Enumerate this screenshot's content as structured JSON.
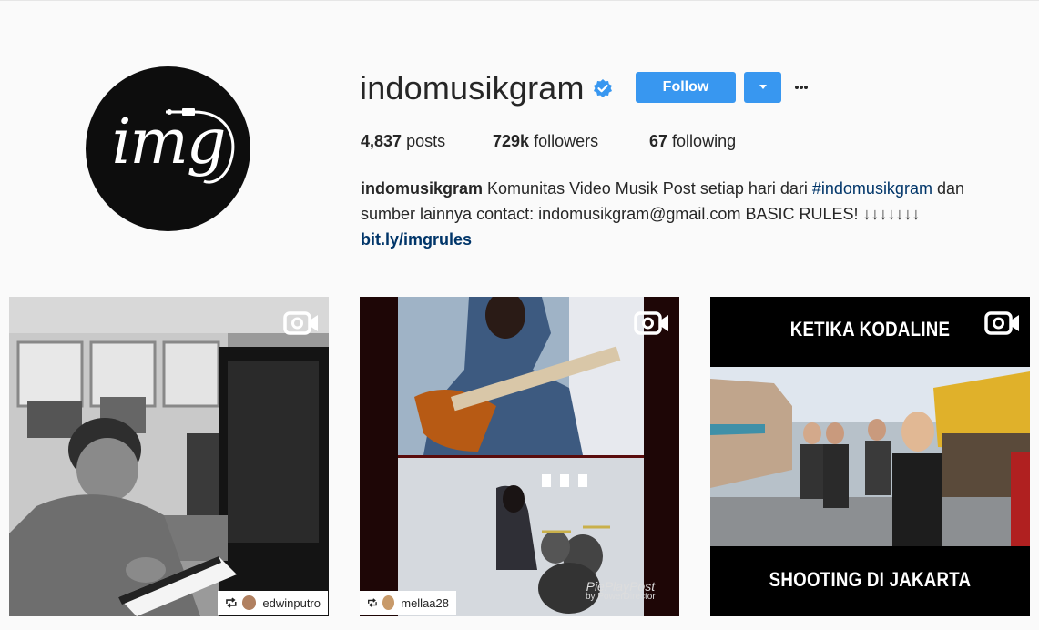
{
  "profile": {
    "username": "indomusikgram",
    "verified": true,
    "avatar_logo_text": "img",
    "follow_label": "Follow",
    "more_label": "•••"
  },
  "stats": {
    "posts_count": "4,837",
    "posts_label": "posts",
    "followers_count": "729k",
    "followers_label": "followers",
    "following_count": "67",
    "following_label": "following"
  },
  "bio": {
    "name": "indomusikgram",
    "text1": " Komunitas Video Musik Post setiap hari dari ",
    "hashtag": "#indomusikgram",
    "text2": " dan sumber lainnya contact: indomusikgram@gmail.com BASIC RULES! ↓↓↓↓↓↓↓",
    "link": "bit.ly/imgrules"
  },
  "posts": [
    {
      "type": "video",
      "repost_user": "edwinputro"
    },
    {
      "type": "video",
      "repost_user": "mellaa28",
      "watermark_line1": "PiePlayPost",
      "watermark_line2": "by PowerDirector"
    },
    {
      "type": "video",
      "caption_top": "KETIKA KODALINE",
      "caption_bottom": "SHOOTING DI JAKARTA"
    }
  ],
  "colors": {
    "accent": "#3897f0",
    "link": "#003569",
    "text": "#262626",
    "background": "#fafafa"
  }
}
